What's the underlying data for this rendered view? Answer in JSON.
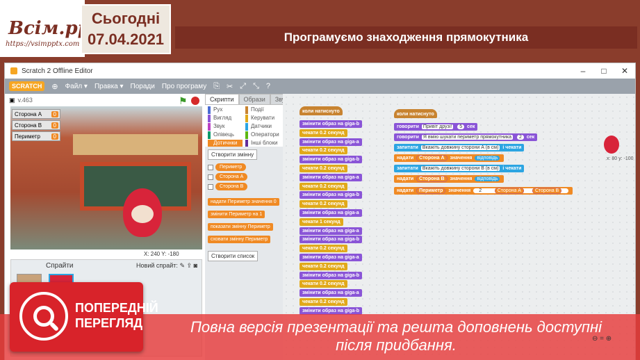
{
  "logo": {
    "title": "Всім.pptx",
    "url": "https://vsimpptx.com"
  },
  "date": {
    "day": "Сьогодні",
    "date": "07.04.2021"
  },
  "slide_title": "Програмуємо знаходження прямокутника",
  "window": {
    "title": "Scratch 2 Offline Editor",
    "menu": [
      "Файл ▾",
      "Правка ▾",
      "Поради",
      "Про програму"
    ],
    "logo": "SCRATCH"
  },
  "stage": {
    "version": "v.463",
    "monitors": [
      {
        "label": "Сторона А",
        "value": "0"
      },
      {
        "label": "Сторона В",
        "value": "0"
      },
      {
        "label": "Периметр",
        "value": "0"
      }
    ],
    "coords": "X: 240  Y: -180"
  },
  "sprites_panel": {
    "title": "Спрайти",
    "new_sprite": "Новий спрайт:"
  },
  "palette_tabs": [
    "Скрипти",
    "Образи",
    "Звуки"
  ],
  "categories": [
    {
      "label": "Рух",
      "color": "#4a6cd4"
    },
    {
      "label": "Події",
      "color": "#c88330"
    },
    {
      "label": "Вигляд",
      "color": "#8a55d7"
    },
    {
      "label": "Керувати",
      "color": "#e1a91a"
    },
    {
      "label": "Звук",
      "color": "#bb42c3"
    },
    {
      "label": "Датчики",
      "color": "#2ca5e2"
    },
    {
      "label": "Олівець",
      "color": "#0e9a6c"
    },
    {
      "label": "Оператори",
      "color": "#5cb712"
    },
    {
      "label": "Дотичнки",
      "color": "#f08a24"
    },
    {
      "label": "Інші блоки",
      "color": "#632d99"
    }
  ],
  "palette": {
    "create_var": "Створити змінну",
    "vars": [
      "Периметр",
      "Сторона А",
      "Сторона В"
    ],
    "blocks": [
      "надати Периметр значення 0",
      "змінити Периметр на 1",
      "показати змінну Периметр",
      "сховати змінну Периметр"
    ],
    "create_list": "Створити список"
  },
  "script_left": {
    "hat": "коли натиснуто",
    "blocks": [
      "змінити образ на giga-b",
      "чекати 0.2 секунд",
      "змінити образ на giga-a",
      "чекати 0.2 секунд",
      "змінити образ на giga-b",
      "чекати 0.2 секунд",
      "змінити образ на giga-a",
      "чекати 0.2 секунд",
      "змінити образ на giga-b",
      "чекати 0.2 секунд",
      "змінити образ на giga-a",
      "чекати 1 секунд",
      "змінити образ на giga-a",
      "змінити образ на giga-b",
      "чекати 0.2 секунд",
      "змінити образ на giga-a",
      "чекати 0.2 секунд",
      "змінити образ на giga-b",
      "чекати 0.2 секунд",
      "змінити образ на giga-a",
      "чекати 0.2 секунд",
      "змінити образ на giga-b"
    ]
  },
  "script_right": {
    "hat": "коли натиснуто",
    "say1": {
      "prefix": "говорити",
      "text": "Привіт друзі!",
      "num": "5",
      "suffix": "сек"
    },
    "say2": {
      "prefix": "говорити",
      "text": "Я вмію шукати периметр прямокутника",
      "num": "2",
      "suffix": "сек"
    },
    "ask1": {
      "prefix": "запитати",
      "text": "Вкажіть довжину сторони А (в см)",
      "suffix": "і чекати"
    },
    "set1": {
      "prefix": "надати",
      "var": "Сторона А",
      "mid": "значення",
      "val": "відповідь"
    },
    "ask2": {
      "prefix": "запитати",
      "text": "Вкажіть довжину сторони В (в см)",
      "suffix": "і чекати"
    },
    "set2": {
      "prefix": "надати",
      "var": "Сторона В",
      "mid": "значення",
      "val": "відповідь"
    },
    "set3": {
      "prefix": "надати",
      "var": "Периметр",
      "mid": "значення",
      "n": "2",
      "mul": "*",
      "a": "Сторона А",
      "plus": "+",
      "b": "Сторона В"
    }
  },
  "sprite_info": "x: 80\ny: -100",
  "overlay": {
    "preview": "ПОПЕРЕДНІЙ ПЕРЕГЛЯД",
    "message": "Повна версія презентації та решта доповнень доступні після придбання."
  }
}
